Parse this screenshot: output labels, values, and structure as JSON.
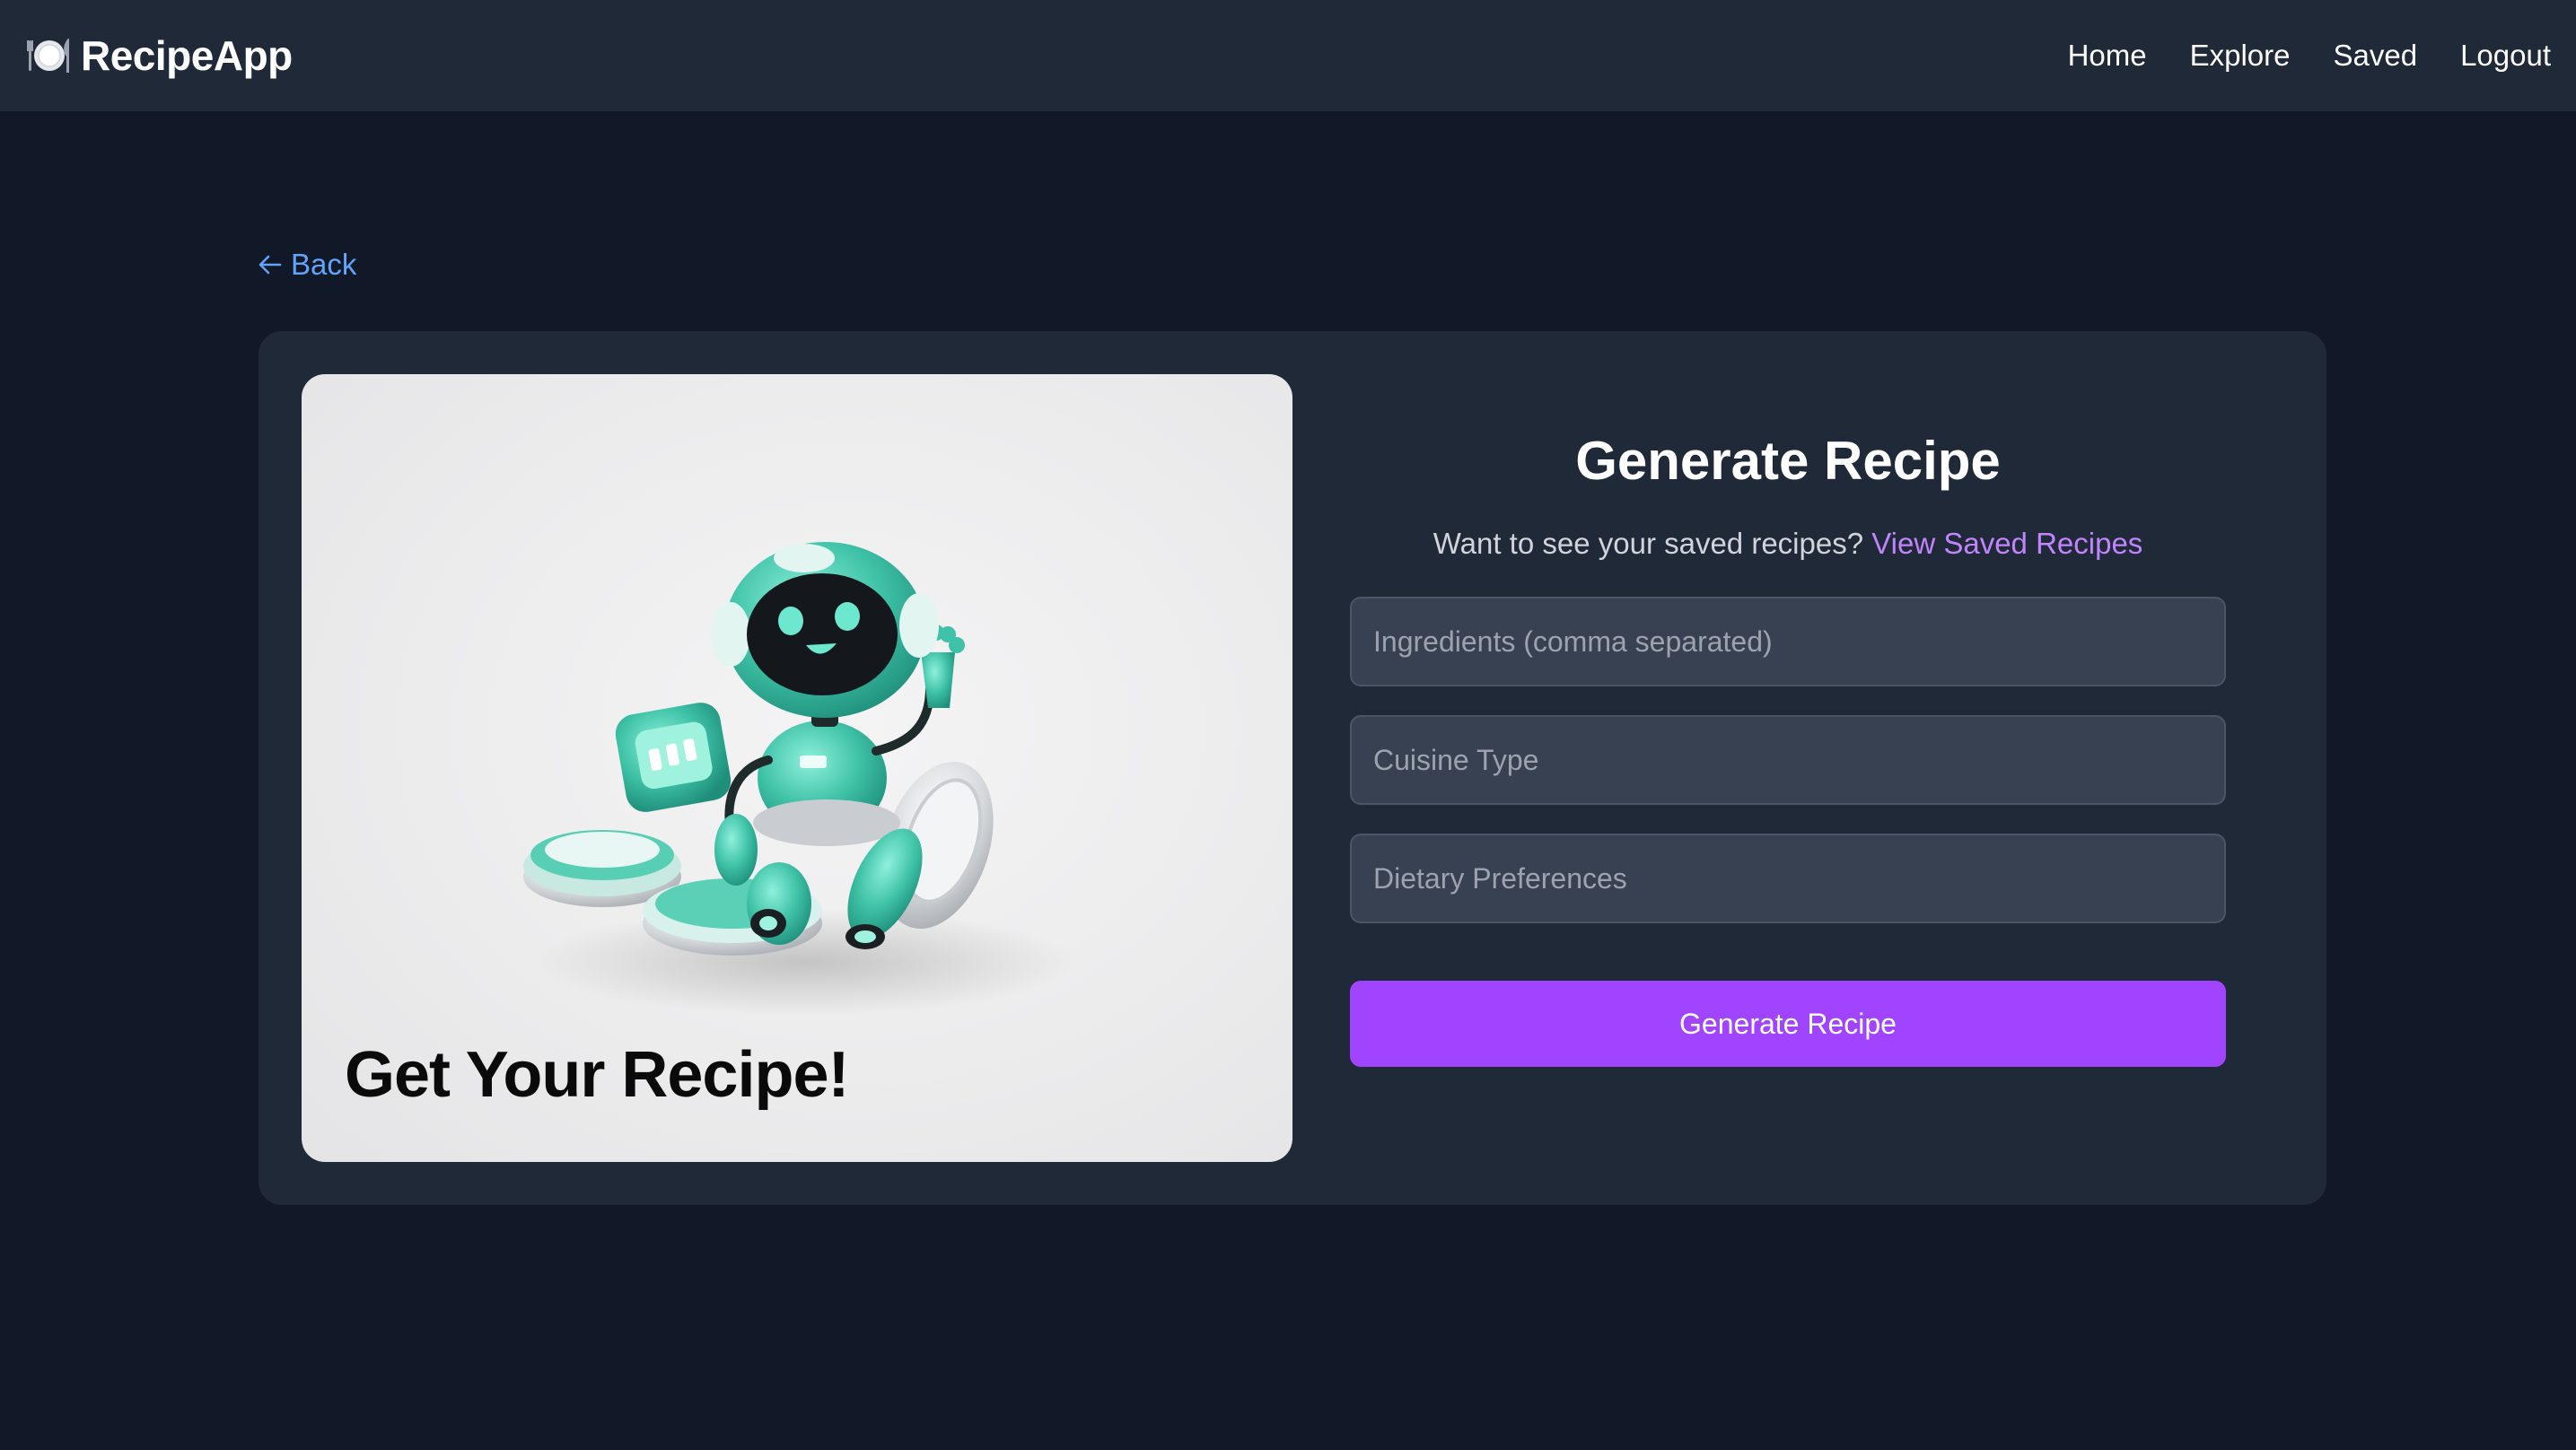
{
  "navbar": {
    "brand": "RecipeApp",
    "brand_icon": "plate-cutlery-icon",
    "links": [
      {
        "label": "Home"
      },
      {
        "label": "Explore"
      },
      {
        "label": "Saved"
      },
      {
        "label": "Logout"
      }
    ]
  },
  "back": {
    "label": "Back",
    "icon": "arrow-left-icon",
    "color": "#60a5fa"
  },
  "hero": {
    "title": "Get Your Recipe!",
    "image": "teal-robot-illustration"
  },
  "form": {
    "title": "Generate Recipe",
    "subtitle": "Want to see your saved recipes?",
    "saved_link": "View Saved Recipes",
    "fields": {
      "ingredients": {
        "placeholder": "Ingredients (comma separated)",
        "value": ""
      },
      "cuisine": {
        "placeholder": "Cuisine Type",
        "value": ""
      },
      "dietary": {
        "placeholder": "Dietary Preferences",
        "value": ""
      }
    },
    "submit_label": "Generate Recipe"
  },
  "colors": {
    "page_bg": "#111827",
    "surface": "#1f2937",
    "input_bg": "#374151",
    "accent": "#a044ff",
    "link_purple": "#c084fc"
  }
}
